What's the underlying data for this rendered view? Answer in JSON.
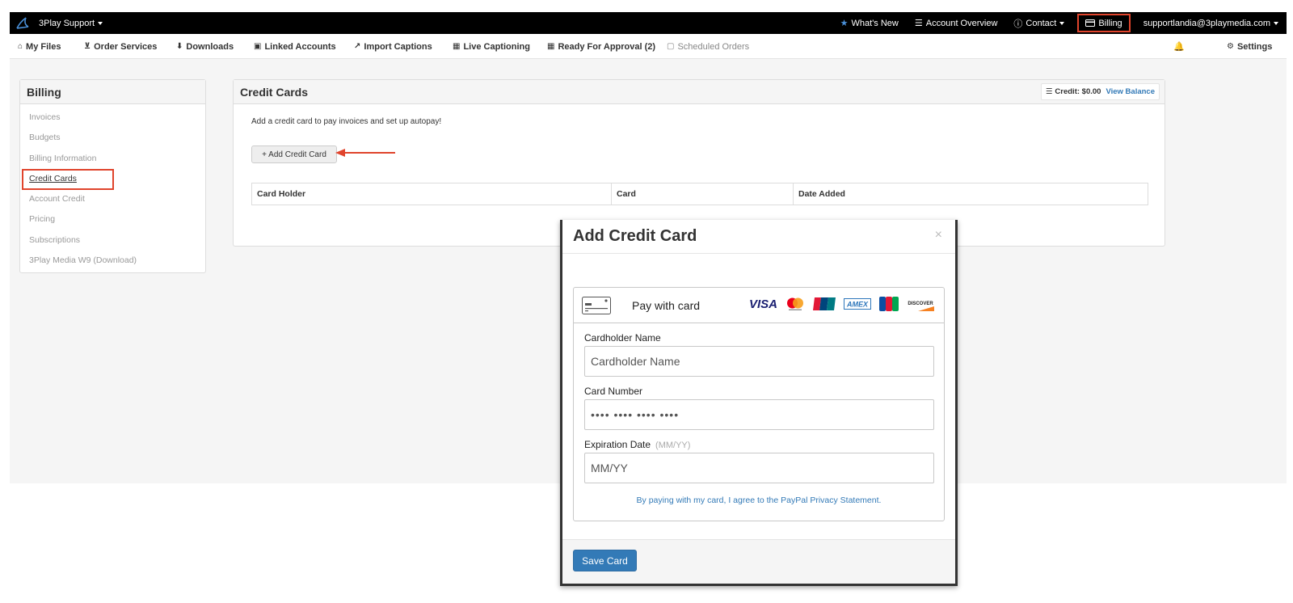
{
  "topbar": {
    "brand": "3Play Support",
    "links": {
      "whats_new": "What's New",
      "account_overview": "Account Overview",
      "contact": "Contact",
      "billing": "Billing",
      "user_email": "supportlandia@3playmedia.com"
    }
  },
  "subnav": {
    "my_files": "My Files",
    "order_services": "Order Services",
    "downloads": "Downloads",
    "linked_accounts": "Linked Accounts",
    "import_captions": "Import Captions",
    "live_captioning": "Live Captioning",
    "ready_for_approval": "Ready For Approval (2)",
    "scheduled_orders": "Scheduled Orders",
    "settings": "Settings"
  },
  "sidebar": {
    "title": "Billing",
    "items": [
      {
        "label": "Invoices"
      },
      {
        "label": "Budgets"
      },
      {
        "label": "Billing Information"
      },
      {
        "label": "Credit Cards"
      },
      {
        "label": "Account Credit"
      },
      {
        "label": "Pricing"
      },
      {
        "label": "Subscriptions"
      },
      {
        "label": "3Play Media W9 (Download)"
      }
    ],
    "active_item": "Credit Cards"
  },
  "panel": {
    "title": "Credit Cards",
    "credit_text": "Credit: $0.00",
    "view_balance": "View Balance",
    "intro": "Add a credit card to pay invoices and set up autopay!",
    "add_button": "+ Add Credit Card",
    "table_headers": [
      "Card Holder",
      "Card",
      "Date Added"
    ]
  },
  "modal": {
    "title": "Add Credit Card",
    "close": "×",
    "pay_with_card": "Pay with card",
    "card_brands": [
      "VISA",
      "Mastercard",
      "UnionPay",
      "AMEX",
      "JCB",
      "DISCOVER"
    ],
    "fields": {
      "cardholder_label": "Cardholder Name",
      "cardholder_placeholder": "Cardholder Name",
      "number_label": "Card Number",
      "number_placeholder": "•••• •••• •••• ••••",
      "expiry_label": "Expiration Date",
      "expiry_hint": "(MM/YY)",
      "expiry_placeholder": "MM/YY"
    },
    "paypal_note": "By paying with my card, I agree to the PayPal Privacy Statement.",
    "save_button": "Save Card"
  },
  "colors": {
    "highlight": "#e0442c",
    "link": "#337ab7",
    "topbar": "#000000",
    "primary_button": "#337ab7"
  }
}
